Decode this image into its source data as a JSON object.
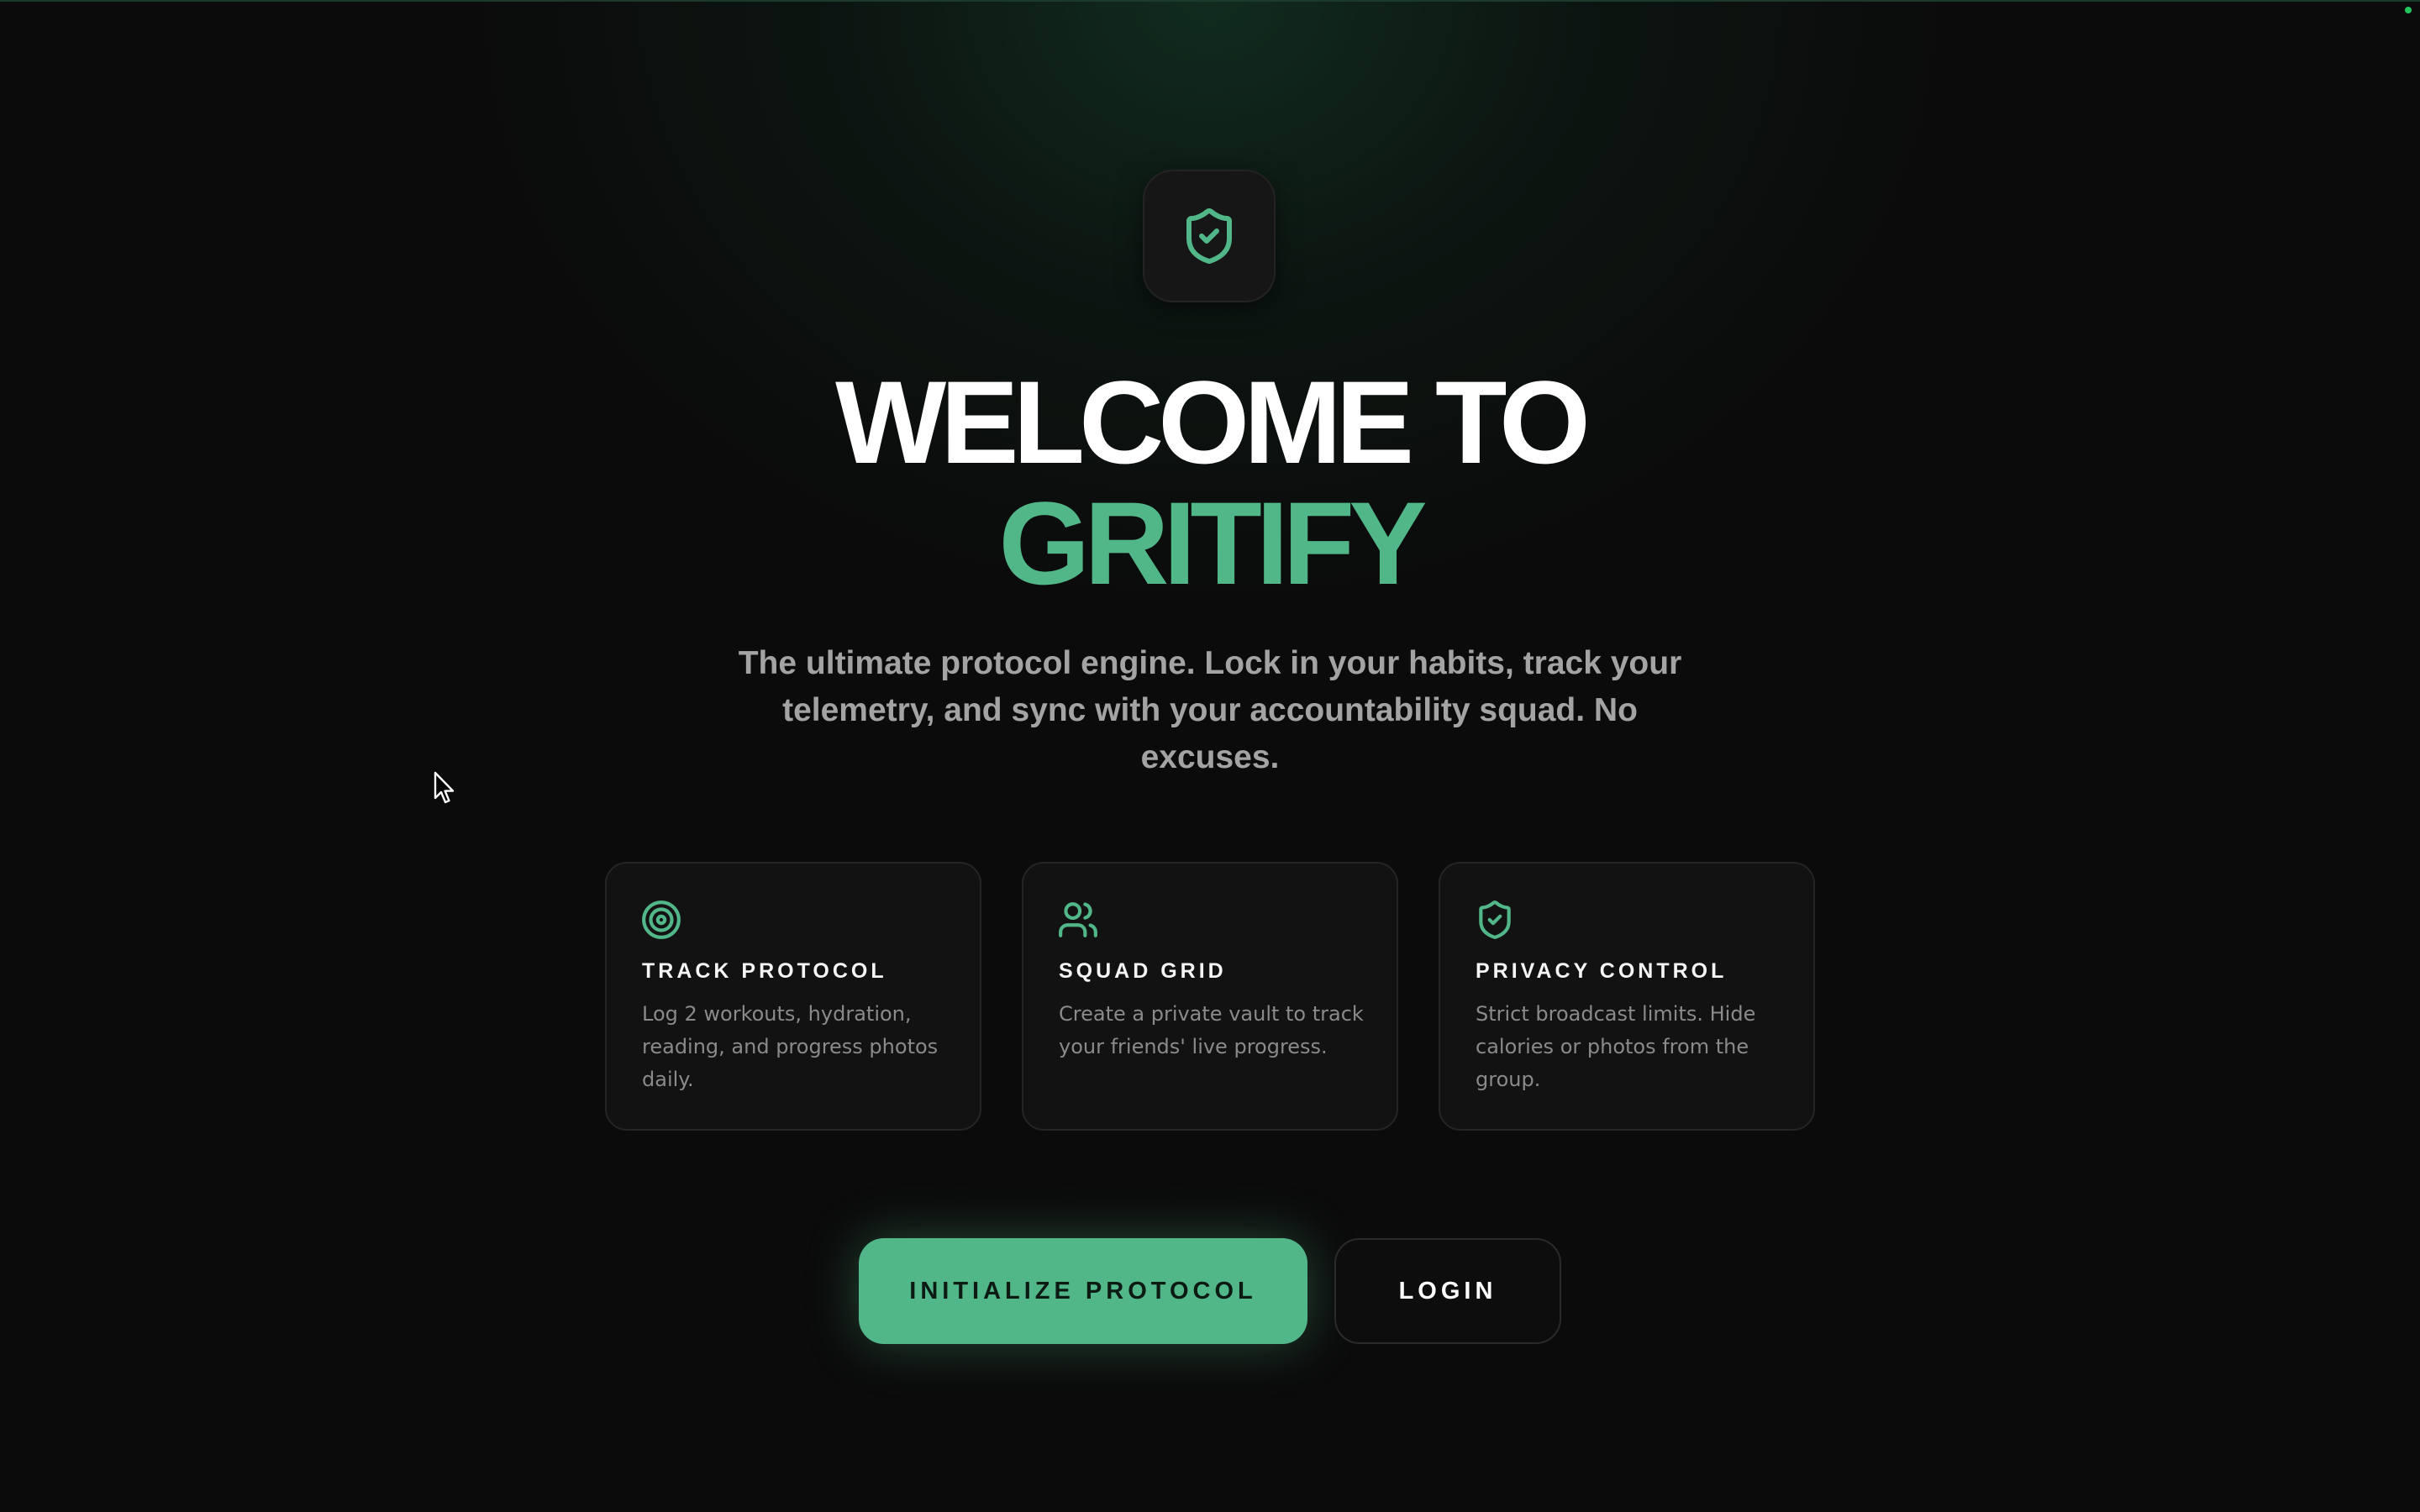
{
  "hero": {
    "title_line_1": "WELCOME TO",
    "title_line_2": "GRITIFY",
    "subtitle": "The ultimate protocol engine. Lock in your habits, track your telemetry, and sync with your accountability squad. No excuses."
  },
  "logo": {
    "icon": "shield-check-icon"
  },
  "features": [
    {
      "icon": "target-icon",
      "title": "TRACK PROTOCOL",
      "description": "Log 2 workouts, hydration, reading, and progress photos daily."
    },
    {
      "icon": "users-icon",
      "title": "SQUAD GRID",
      "description": "Create a private vault to track your friends' live progress."
    },
    {
      "icon": "shield-check-icon",
      "title": "PRIVACY CONTROL",
      "description": "Strict broadcast limits. Hide calories or photos from the group."
    }
  ],
  "actions": {
    "primary_label": "INITIALIZE PROTOCOL",
    "secondary_label": "LOGIN"
  },
  "colors": {
    "accent": "#52b788",
    "background": "#0b0b0b",
    "card": "#121212",
    "muted_text": "#a3a3a3"
  }
}
